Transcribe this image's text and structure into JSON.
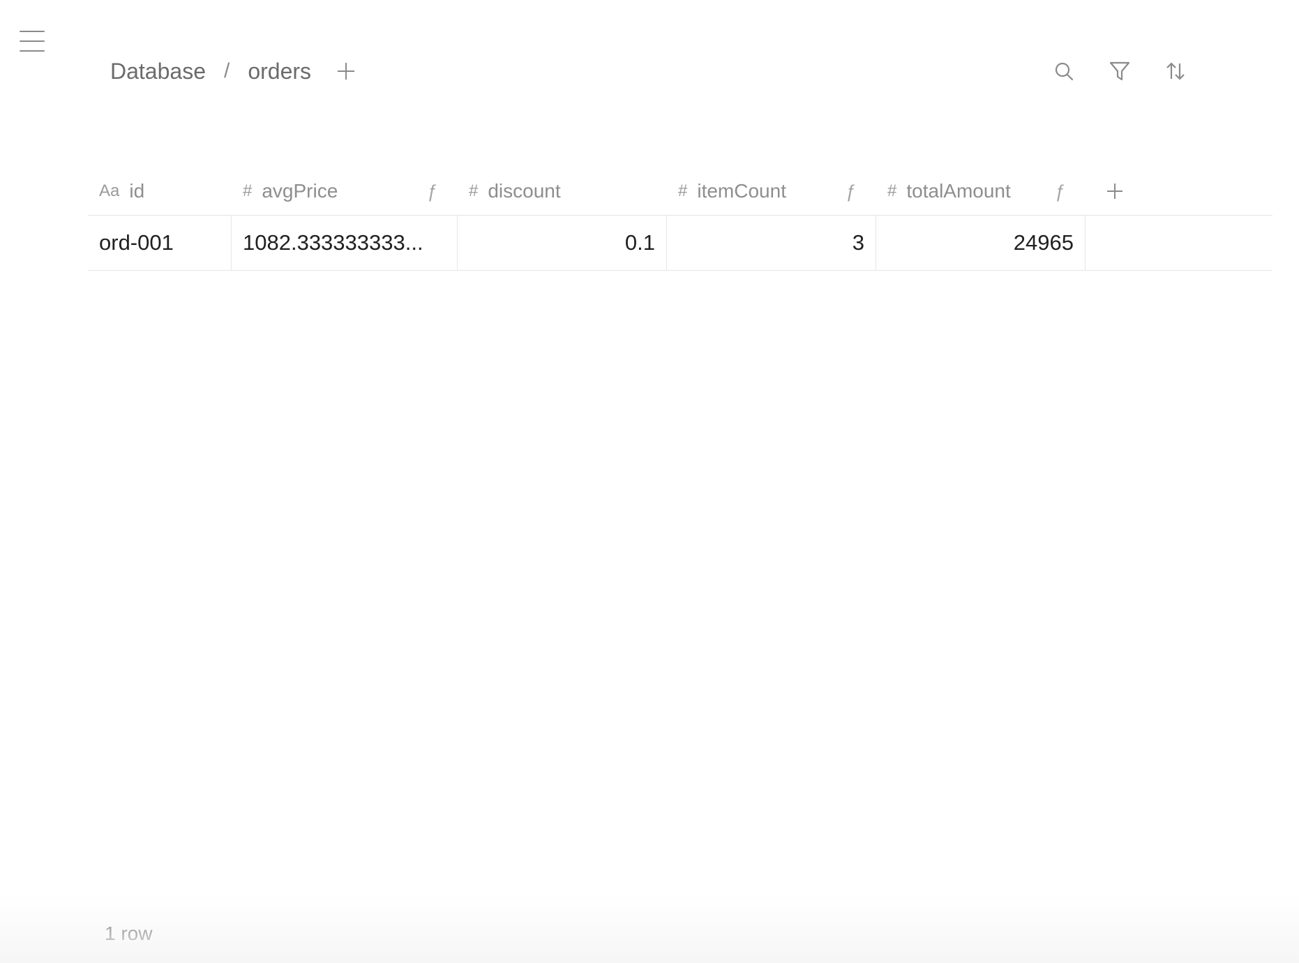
{
  "nav": {
    "menu_icon": "hamburger-menu-icon"
  },
  "breadcrumb": {
    "root": "Database",
    "separator": "/",
    "current": "orders",
    "add_icon": "plus-icon"
  },
  "toolbar": {
    "search_icon": "search-icon",
    "filter_icon": "filter-icon",
    "sort_icon": "sort-arrows-icon"
  },
  "table": {
    "columns": [
      {
        "type_label": "Aa",
        "name": "id",
        "formula": ""
      },
      {
        "type_label": "#",
        "name": "avgPrice",
        "formula": "ƒ"
      },
      {
        "type_label": "#",
        "name": "discount",
        "formula": ""
      },
      {
        "type_label": "#",
        "name": "itemCount",
        "formula": "ƒ"
      },
      {
        "type_label": "#",
        "name": "totalAmount",
        "formula": "ƒ"
      }
    ],
    "rows": [
      {
        "cells": [
          "ord-001",
          "1082.333333333...",
          "0.1",
          "3",
          "24965"
        ]
      }
    ]
  },
  "footer": {
    "row_count": "1 row"
  }
}
